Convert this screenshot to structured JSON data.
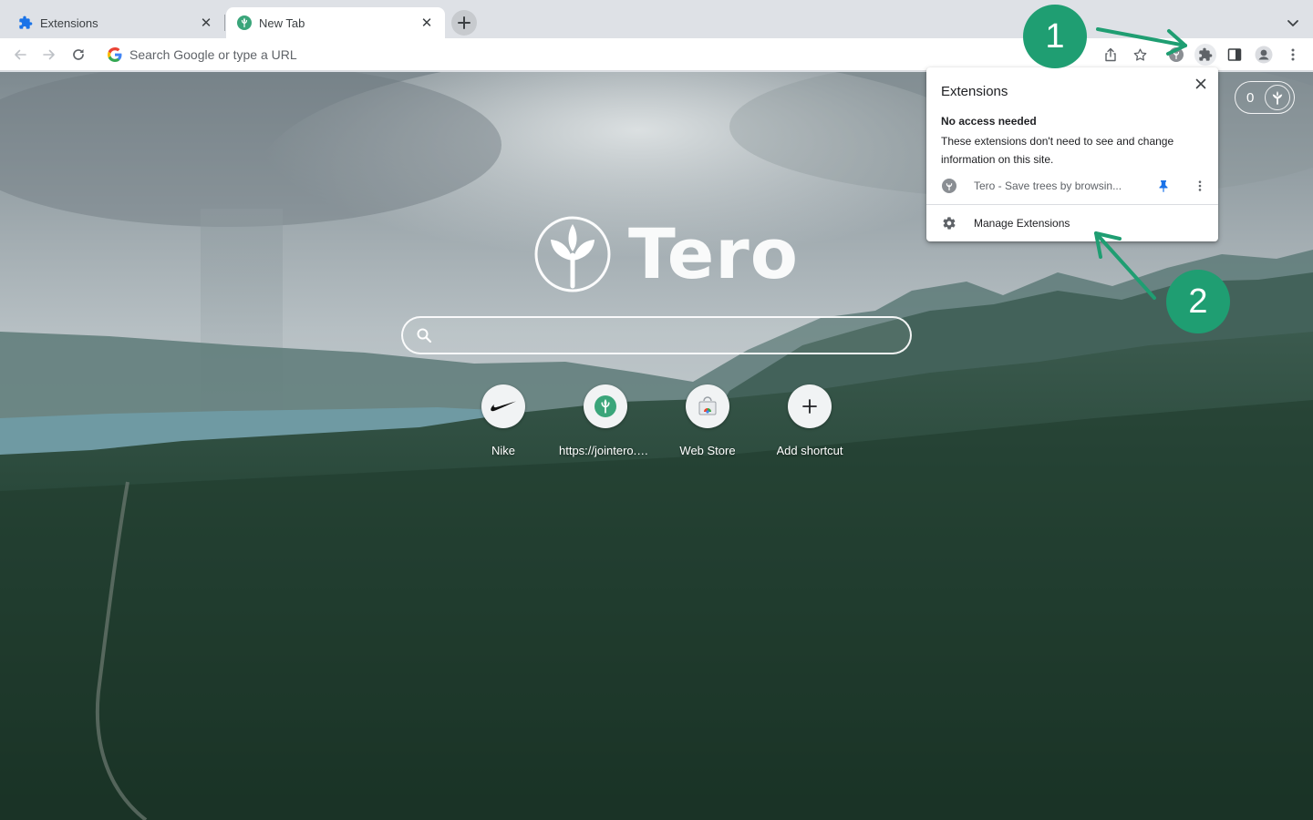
{
  "tabs": [
    {
      "title": "Extensions",
      "icon": "puzzle-icon",
      "active": false
    },
    {
      "title": "New Tab",
      "icon": "tero-leaf-icon",
      "active": true
    }
  ],
  "toolbar": {
    "omnibox_placeholder": "Search Google or type a URL"
  },
  "newtab": {
    "brand": "Tero",
    "search_placeholder": "",
    "tree_count": "0",
    "shortcuts": [
      {
        "label": "Nike",
        "icon": "nike-swoosh-icon"
      },
      {
        "label": "https://jointero.org",
        "icon": "tero-leaf-icon"
      },
      {
        "label": "Web Store",
        "icon": "web-store-icon"
      },
      {
        "label": "Add shortcut",
        "icon": "plus-icon"
      }
    ]
  },
  "extensions_popup": {
    "title": "Extensions",
    "section_heading": "No access needed",
    "section_desc": "These extensions don't need to see and change information on this site.",
    "extension_name": "Tero - Save trees by browsin...",
    "manage_label": "Manage Extensions"
  },
  "annotations": {
    "step1": "1",
    "step2": "2",
    "color": "#1f9e72"
  }
}
